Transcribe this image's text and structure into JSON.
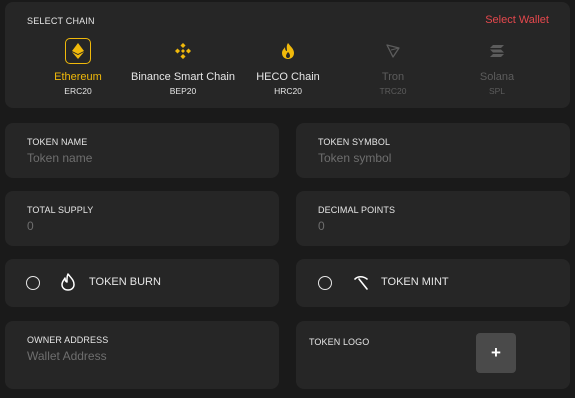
{
  "chain_select": {
    "label": "SELECT CHAIN",
    "wallet_link": "Select Wallet",
    "chains": [
      {
        "name": "Ethereum",
        "standard": "ERC20",
        "icon": "ethereum-icon",
        "state": "selected"
      },
      {
        "name": "Binance Smart Chain",
        "standard": "BEP20",
        "icon": "binance-icon",
        "state": "available"
      },
      {
        "name": "HECO Chain",
        "standard": "HRC20",
        "icon": "heco-icon",
        "state": "available"
      },
      {
        "name": "Tron",
        "standard": "TRC20",
        "icon": "tron-icon",
        "state": "disabled"
      },
      {
        "name": "Solana",
        "standard": "SPL",
        "icon": "solana-icon",
        "state": "disabled"
      }
    ]
  },
  "fields": {
    "token_name": {
      "label": "TOKEN NAME",
      "placeholder": "Token name",
      "value": ""
    },
    "token_symbol": {
      "label": "TOKEN SYMBOL",
      "placeholder": "Token symbol",
      "value": ""
    },
    "total_supply": {
      "label": "TOTAL SUPPLY",
      "placeholder": "0",
      "value": ""
    },
    "decimal_points": {
      "label": "DECIMAL POINTS",
      "placeholder": "0",
      "value": ""
    },
    "owner_address": {
      "label": "OWNER ADDRESS",
      "placeholder": "Wallet Address",
      "value": ""
    }
  },
  "options": {
    "token_burn": {
      "label": "TOKEN BURN",
      "icon": "flame-icon",
      "checked": false
    },
    "token_mint": {
      "label": "TOKEN MINT",
      "icon": "pickaxe-icon",
      "checked": false
    }
  },
  "token_logo": {
    "label": "TOKEN LOGO",
    "button": "+"
  },
  "colors": {
    "accent": "#f0b90b",
    "link": "#e5484d",
    "card": "#262626",
    "background": "#1a1a1a"
  }
}
